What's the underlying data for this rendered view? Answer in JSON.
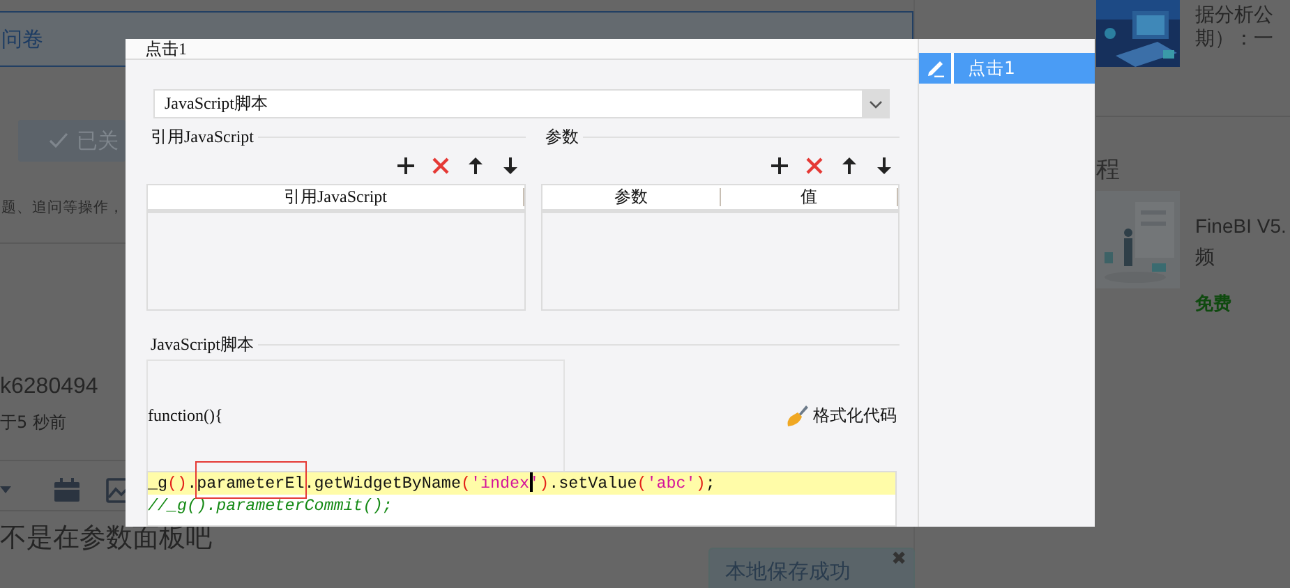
{
  "background_page": {
    "tab_label": "问卷",
    "follow_button": "已关",
    "hint_text": "题、追问等操作，",
    "user_name": "k6280494",
    "post_time": "于5 秒前",
    "reply_text": "不是在参数面板吧",
    "toast": {
      "message": "本地保存成功",
      "close": "✖"
    },
    "sidebar": {
      "article_lines": [
        "据分析公",
        "期）：一"
      ],
      "section_heading": "程",
      "course": {
        "title_lines": [
          "FineBI V5.",
          "频"
        ],
        "price": "免费"
      }
    }
  },
  "dialog": {
    "title": "点击1",
    "events": [
      {
        "label": "点击1",
        "selected": true
      }
    ],
    "type_select": {
      "value": "JavaScript脚本"
    },
    "imports": {
      "legend": "引用JavaScript",
      "columns": [
        "引用JavaScript"
      ]
    },
    "params": {
      "legend": "参数",
      "columns": [
        "参数",
        "值"
      ]
    },
    "script": {
      "legend": "JavaScript脚本",
      "header_line": "function(){",
      "format_button": "格式化代码",
      "lines": [
        {
          "highlighted": true,
          "tokens": [
            {
              "kind": "plain",
              "text": "_g"
            },
            {
              "kind": "paren",
              "text": "()"
            },
            {
              "kind": "plain",
              "text": "."
            },
            {
              "kind": "plain",
              "text": "parameterEl",
              "boxed": true
            },
            {
              "kind": "plain",
              "text": ".getWidgetByName"
            },
            {
              "kind": "paren",
              "text": "("
            },
            {
              "kind": "string",
              "text": "'index"
            },
            {
              "kind": "caret"
            },
            {
              "kind": "string",
              "text": "'"
            },
            {
              "kind": "paren",
              "text": ")"
            },
            {
              "kind": "plain",
              "text": ".setValue"
            },
            {
              "kind": "paren",
              "text": "("
            },
            {
              "kind": "string",
              "text": "'abc'"
            },
            {
              "kind": "paren",
              "text": ")"
            },
            {
              "kind": "plain",
              "text": ";"
            }
          ]
        },
        {
          "highlighted": false,
          "tokens": [
            {
              "kind": "comment",
              "text": "//_g().parameterCommit();"
            }
          ]
        }
      ]
    }
  }
}
